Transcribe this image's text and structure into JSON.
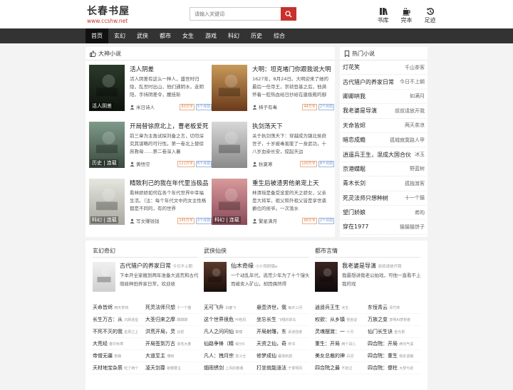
{
  "header": {
    "logo_title": "长春书屋",
    "logo_url": "www.ccshw.net",
    "search_placeholder": "请输入关键词",
    "links": [
      {
        "label": "书库",
        "icon": "books-icon"
      },
      {
        "label": "完本",
        "icon": "coffee-icon"
      },
      {
        "label": "足迹",
        "icon": "history-icon"
      }
    ]
  },
  "nav": [
    "首页",
    "玄幻",
    "武侠",
    "都市",
    "女生",
    "游戏",
    "科幻",
    "历史",
    "综合"
  ],
  "featured": {
    "title": "大神小说",
    "books": [
      {
        "title": "活人阴差",
        "desc": "活人阴差有这么一种人，盛世时归隐，乱世时出山，他们通阴水，走阴阳，手持阴差令，腰挂斩",
        "author": "米日诗人",
        "tag1": "83万字",
        "tag2": "5个月前",
        "cover_text": "活人阴差",
        "c1": "#2b3a2a",
        "c2": "#0d120c"
      },
      {
        "title": "大明：坦克堵门你跟我说大明",
        "desc": "1627年，8月24日。大明迎来了她的最后一任帝王，崇祯登基之后，他满怀着一腔热血给日抄给在建极殿的御阶上，接受百官",
        "author": "柿子有毒",
        "tag1": "44万字",
        "tag2": "2个月前",
        "cover_text": "",
        "c1": "#c89a5a",
        "c2": "#6a3a1a"
      },
      {
        "title": "开局替徐庶北上，曹老板爱死",
        "desc": "前三章为主角试探刘备之言，切勿深究其谋略的可行性。第一卷北上替徐庶救母……第二卷深入襄",
        "author": "黄悟空",
        "tag1": "111万字",
        "tag2": "6个月前",
        "cover_text": "历史 | 连载",
        "c1": "#7e9a8a",
        "c2": "#3a4a3e"
      },
      {
        "title": "执剑荡天下",
        "desc": "关于执剑荡天下：穿越成为镇北侯府世子，十岁被毒害废了一身武功，十八岁血染长安，搅起天边",
        "author": "秋夏寒",
        "tag1": "100万字",
        "tag2": "8个月前",
        "cover_text": "",
        "c1": "#d8d8d8",
        "c2": "#8a8a8a"
      },
      {
        "title": "精致利己的我在年代里当极品",
        "desc": "看林娇娇如何在各个年代世界中幸福生活。（注：每个年代文中的女主性格都是不同的，有的世界",
        "author": "写文赚钱钱",
        "tag1": "245万字",
        "tag2": "2个月前",
        "cover_text": "科幻 | 连载",
        "c1": "#e6e6e0",
        "c2": "#a8a8a0"
      },
      {
        "title": "重生后被渣男他弟宠上天",
        "desc": "林清瑶是备受宠爱的天之骄女，父亲是大将军，祖父和外祖父皆是享世袭爵位的侯爷。一次落水",
        "author": "繁星满月",
        "tag1": "66万字",
        "tag2": "2个月前",
        "cover_text": "科幻 | 连载",
        "c1": "#d89a9a",
        "c2": "#8a4a5a"
      }
    ]
  },
  "hot": {
    "title": "热门小说",
    "items": [
      {
        "title": "灯花笑",
        "author": "千山茶客"
      },
      {
        "title": "古代猎户的养家日常",
        "author": "今日不上朝"
      },
      {
        "title": "卿卿哄我",
        "author": "如满月"
      },
      {
        "title": "我老婆是导演",
        "author": "叔叔请放开我"
      },
      {
        "title": "天命皆烬",
        "author": "两天茶凉"
      },
      {
        "title": "暗恋成瘾",
        "author": "孤城寂寞路人甲"
      },
      {
        "title": "逍遥兵王生，混成大国合伙",
        "author": "冰玉"
      },
      {
        "title": "京港蝶眠",
        "author": "野蓝树"
      },
      {
        "title": "青木长剑",
        "author": "孤独渡客"
      },
      {
        "title": "死灵法师只想种树",
        "author": "十一个猫"
      },
      {
        "title": "望门娇娘",
        "author": "希昀"
      },
      {
        "title": "穿在1977",
        "author": "猫猫猫饼子"
      }
    ]
  },
  "categories": [
    {
      "name": "玄幻奇幻",
      "feat_title": "古代猎户的养家日常",
      "feat_author": "今日不上朝",
      "feat_desc": "下本开全家搬到两年准备大逃荒和古代萌娃种田养家日常，欢迎收",
      "feat_c1": "#f0f0f0",
      "feat_c2": "#cfcfcf",
      "items": [
        {
          "t": "天命皆烬",
          "a": "两天茶饼"
        },
        {
          "t": "死灵法师只想",
          "a": "十一个猫"
        },
        {
          "t": "长生万古：从",
          "a": "沉默逐星"
        },
        {
          "t": "大圣归来之摩",
          "a": "蹲蹲蹲"
        },
        {
          "t": "不死不灭的我",
          "a": "星辰之上"
        },
        {
          "t": "洪荒开局，灵",
          "a": "云碧"
        },
        {
          "t": "大荒经",
          "a": "春华秋寒"
        },
        {
          "t": "开局签到万古",
          "a": "洛宅大春"
        },
        {
          "t": "帝僧无疆",
          "a": "荒娘"
        },
        {
          "t": "大道至主",
          "a": "傅雨"
        },
        {
          "t": "天材地宝杂质",
          "a": "吃了两个"
        },
        {
          "t": "凌天剑尊",
          "a": "破雾群主"
        }
      ]
    },
    {
      "name": "武侠仙侠",
      "feat_title": "仙木奇缘",
      "feat_author": "小小阳财猿a",
      "feat_desc": "一个动乱年代，逃荒少年为了十个馒头而被卖入矿山，却因偶然得",
      "feat_c1": "#5a3a2a",
      "feat_c2": "#1a0e0a",
      "items": [
        {
          "t": "无可飞升",
          "a": "白鹿飞"
        },
        {
          "t": "悬壶济世，我",
          "a": "每天三问"
        },
        {
          "t": "这个世界很危",
          "a": "叶皓风"
        },
        {
          "t": "坐忘长生",
          "a": "飞翔的翠鸟"
        },
        {
          "t": "凡人之问问仙",
          "a": "秦模"
        },
        {
          "t": "开局射雕，东",
          "a": "武道强者"
        },
        {
          "t": "仙路争锋（精",
          "a": "缘分0"
        },
        {
          "t": "天资之仙，奇",
          "a": "奇书"
        },
        {
          "t": "凡人：拽月宗",
          "a": "雷斗仕"
        },
        {
          "t": "修梦成仙",
          "a": "暮落秋韵"
        },
        {
          "t": "烟雨锈剑",
          "a": "上风的春潮"
        },
        {
          "t": "打坐就能涨法",
          "a": "于季明风"
        }
      ]
    },
    {
      "name": "都市言情",
      "feat_title": "我老婆是导演",
      "feat_author": "叔叔请放开我",
      "feat_desc": "我最想讲我老公拍戏，可他一直看不上我的戏",
      "feat_c1": "#3a2420",
      "feat_c2": "#0e0a0a",
      "items": [
        {
          "t": "逍遥兵王生",
          "a": "冰玉"
        },
        {
          "t": "东恒青云",
          "a": "青竹林"
        },
        {
          "t": "权欲：从乡镇",
          "a": "怪兽说"
        },
        {
          "t": "万族之变",
          "a": "李明AI梦想者"
        },
        {
          "t": "灵魂摆渡：一",
          "a": "十月"
        },
        {
          "t": "仙门长生诀",
          "a": "金光景"
        },
        {
          "t": "重生：开局",
          "a": "两个哥儿"
        },
        {
          "t": "四合院：开局",
          "a": "两句气溪"
        },
        {
          "t": "美女总裁的神",
          "a": "白羽"
        },
        {
          "t": "四合院：重生",
          "a": "我友谊猪"
        },
        {
          "t": "四合院之最",
          "a": "不抚过"
        },
        {
          "t": "四合院：傻柱",
          "a": "大梦与泉"
        }
      ]
    }
  ],
  "colors": {
    "accent": "#c9302c",
    "nav_bg": "#333333",
    "page_bg": "#f3f3f3"
  }
}
